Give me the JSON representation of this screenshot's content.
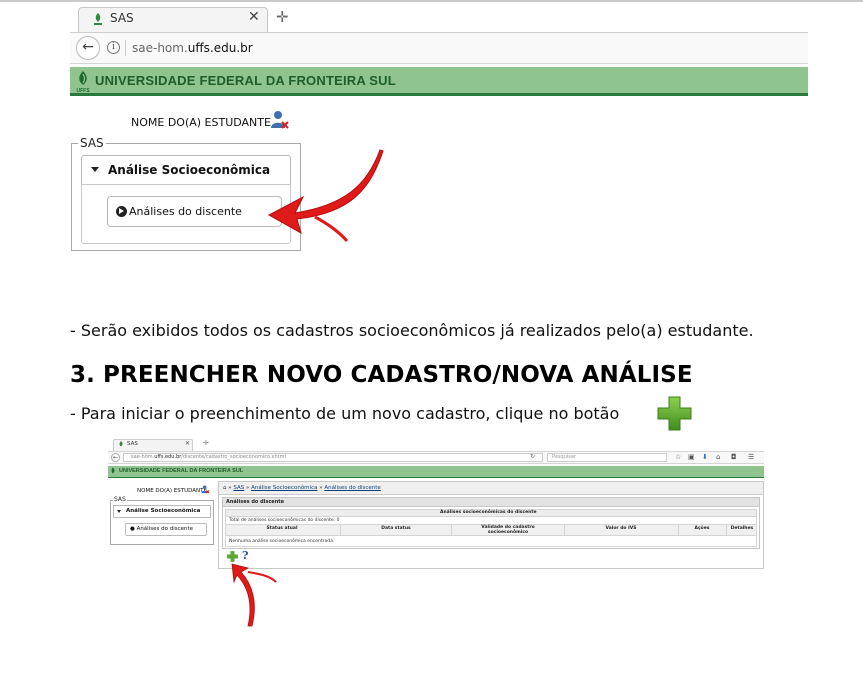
{
  "browser": {
    "tab_title": "SAS",
    "url_prefix": "sae-hom.",
    "url_domain": "uffs.edu.br"
  },
  "banner": {
    "title": "UNIVERSIDADE FEDERAL DA FRONTEIRA SUL",
    "logo_text": "UFFS"
  },
  "student": {
    "name_label": "NOME DO(A) ESTUDANTE"
  },
  "sas_menu": {
    "legend": "SAS",
    "section_label": "Análise Socioeconômica",
    "link_label": "Análises do discente"
  },
  "document": {
    "paragraph1": "- Serão exibidos todos os cadastros socioeconômicos já realizados pelo(a) estudante.",
    "heading": "3. PREENCHER NOVO CADASTRO/NOVA ANÁLISE",
    "paragraph2": "- Para iniciar o preenchimento de um novo cadastro, clique no botão"
  },
  "small_screenshot": {
    "tab_title": "SAS",
    "url_prefix": "sae-hom.",
    "url_domain": "uffs.edu.br",
    "url_path": "/discente/cadastro_socioeconomico.xhtml",
    "search_placeholder": "Pesquisar",
    "banner_title": "UNIVERSIDADE FEDERAL DA FRONTEIRA SUL",
    "student_label": "NOME DO(A) ESTUDANTE",
    "sas_legend": "SAS",
    "section_label": "Análise Socioeconômica",
    "link_label": "Análises do discente",
    "breadcrumb": {
      "home": "⌂",
      "sep": "»",
      "items": [
        "SAS",
        "Análise Socioeconômica",
        "Análises do discente"
      ]
    },
    "panel_title": "Análises do discente",
    "table_caption": "Análises socioeconômicas do discente",
    "total_text": "Total de análises socioeconômicas do discente: 0",
    "columns": [
      "Status atual",
      "Data status",
      "Validade do cadastro socioeconômico",
      "Valor do IVS",
      "Ações",
      "Detalhes"
    ],
    "empty_text": "Nenhuma análise socioeconômica encontrada.",
    "help_symbol": "?"
  },
  "colors": {
    "banner_green": "#8fc48e",
    "banner_text": "#1e5e2c",
    "arrow_red": "#e01919",
    "plus_green": "#5aab2d"
  }
}
